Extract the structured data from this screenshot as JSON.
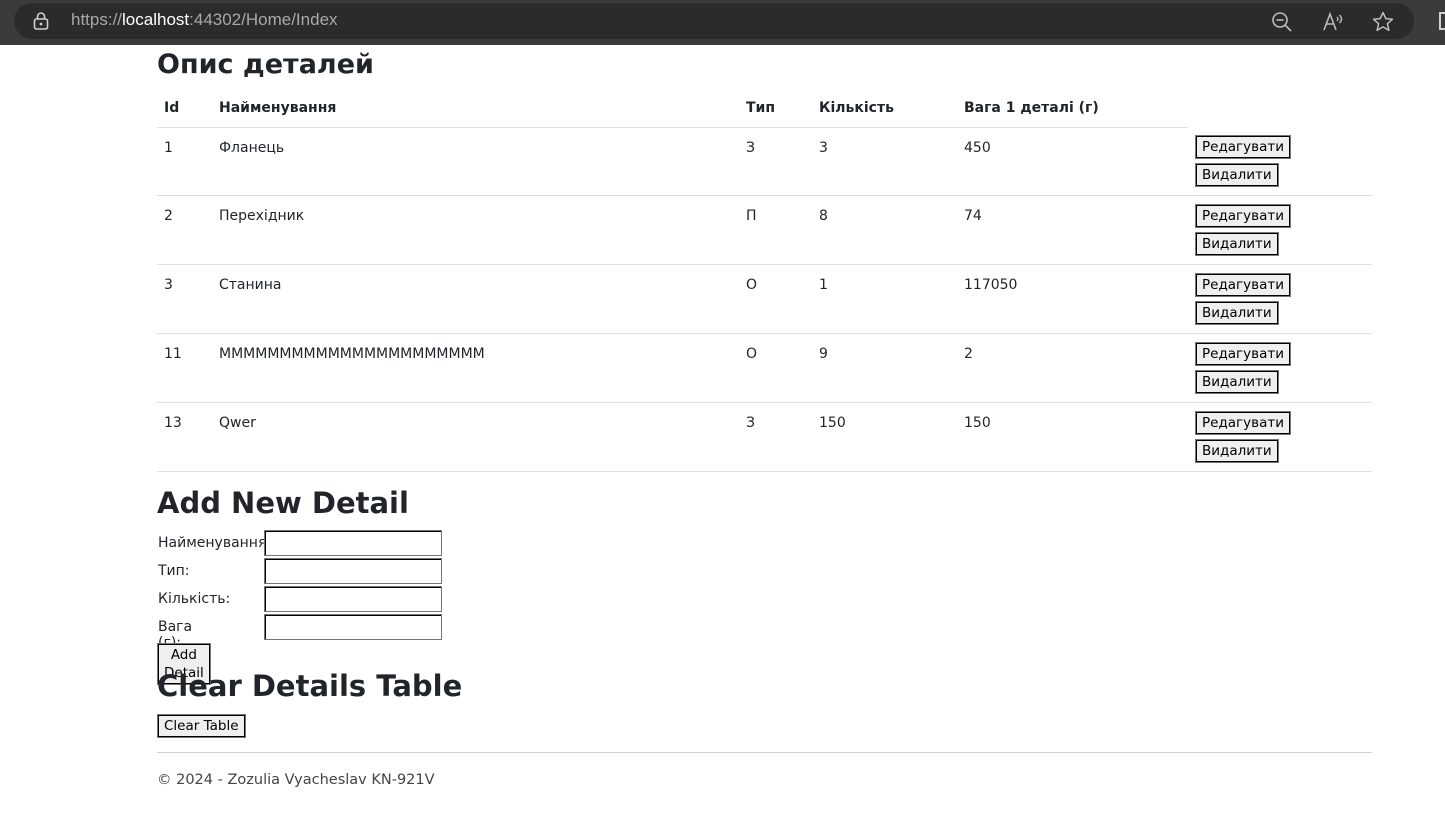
{
  "browser": {
    "url_scheme": "https://",
    "url_host": "localhost",
    "url_rest": ":44302/Home/Index"
  },
  "details": {
    "title": "Опис деталей",
    "columns": [
      "Id",
      "Найменування",
      "Тип",
      "Кількість",
      "Вага 1 деталі (г)"
    ],
    "rows": [
      {
        "id": "1",
        "name": "Фланець",
        "type": "З",
        "qty": "3",
        "weight": "450"
      },
      {
        "id": "2",
        "name": "Перехідник",
        "type": "П",
        "qty": "8",
        "weight": "74"
      },
      {
        "id": "3",
        "name": "Станина",
        "type": "О",
        "qty": "1",
        "weight": "117050"
      },
      {
        "id": "11",
        "name": "MMMMMMMMMMMMMMMMMMMMMM",
        "type": "О",
        "qty": "9",
        "weight": "2"
      },
      {
        "id": "13",
        "name": "Qwer",
        "type": "З",
        "qty": "150",
        "weight": "150"
      }
    ],
    "edit_label": "Редагувати",
    "delete_label": "Видалити"
  },
  "add_form": {
    "title": "Add New Detail",
    "name_label": "Найменування:",
    "type_label": "Тип:",
    "qty_label": "Кількість:",
    "weight_label": "Вага (г):",
    "submit_label": "Add Detail"
  },
  "clear": {
    "title": "Clear Details Table",
    "button_label": "Clear Table"
  },
  "footer": {
    "text": "© 2024 - Zozulia Vyacheslav KN-921V"
  }
}
